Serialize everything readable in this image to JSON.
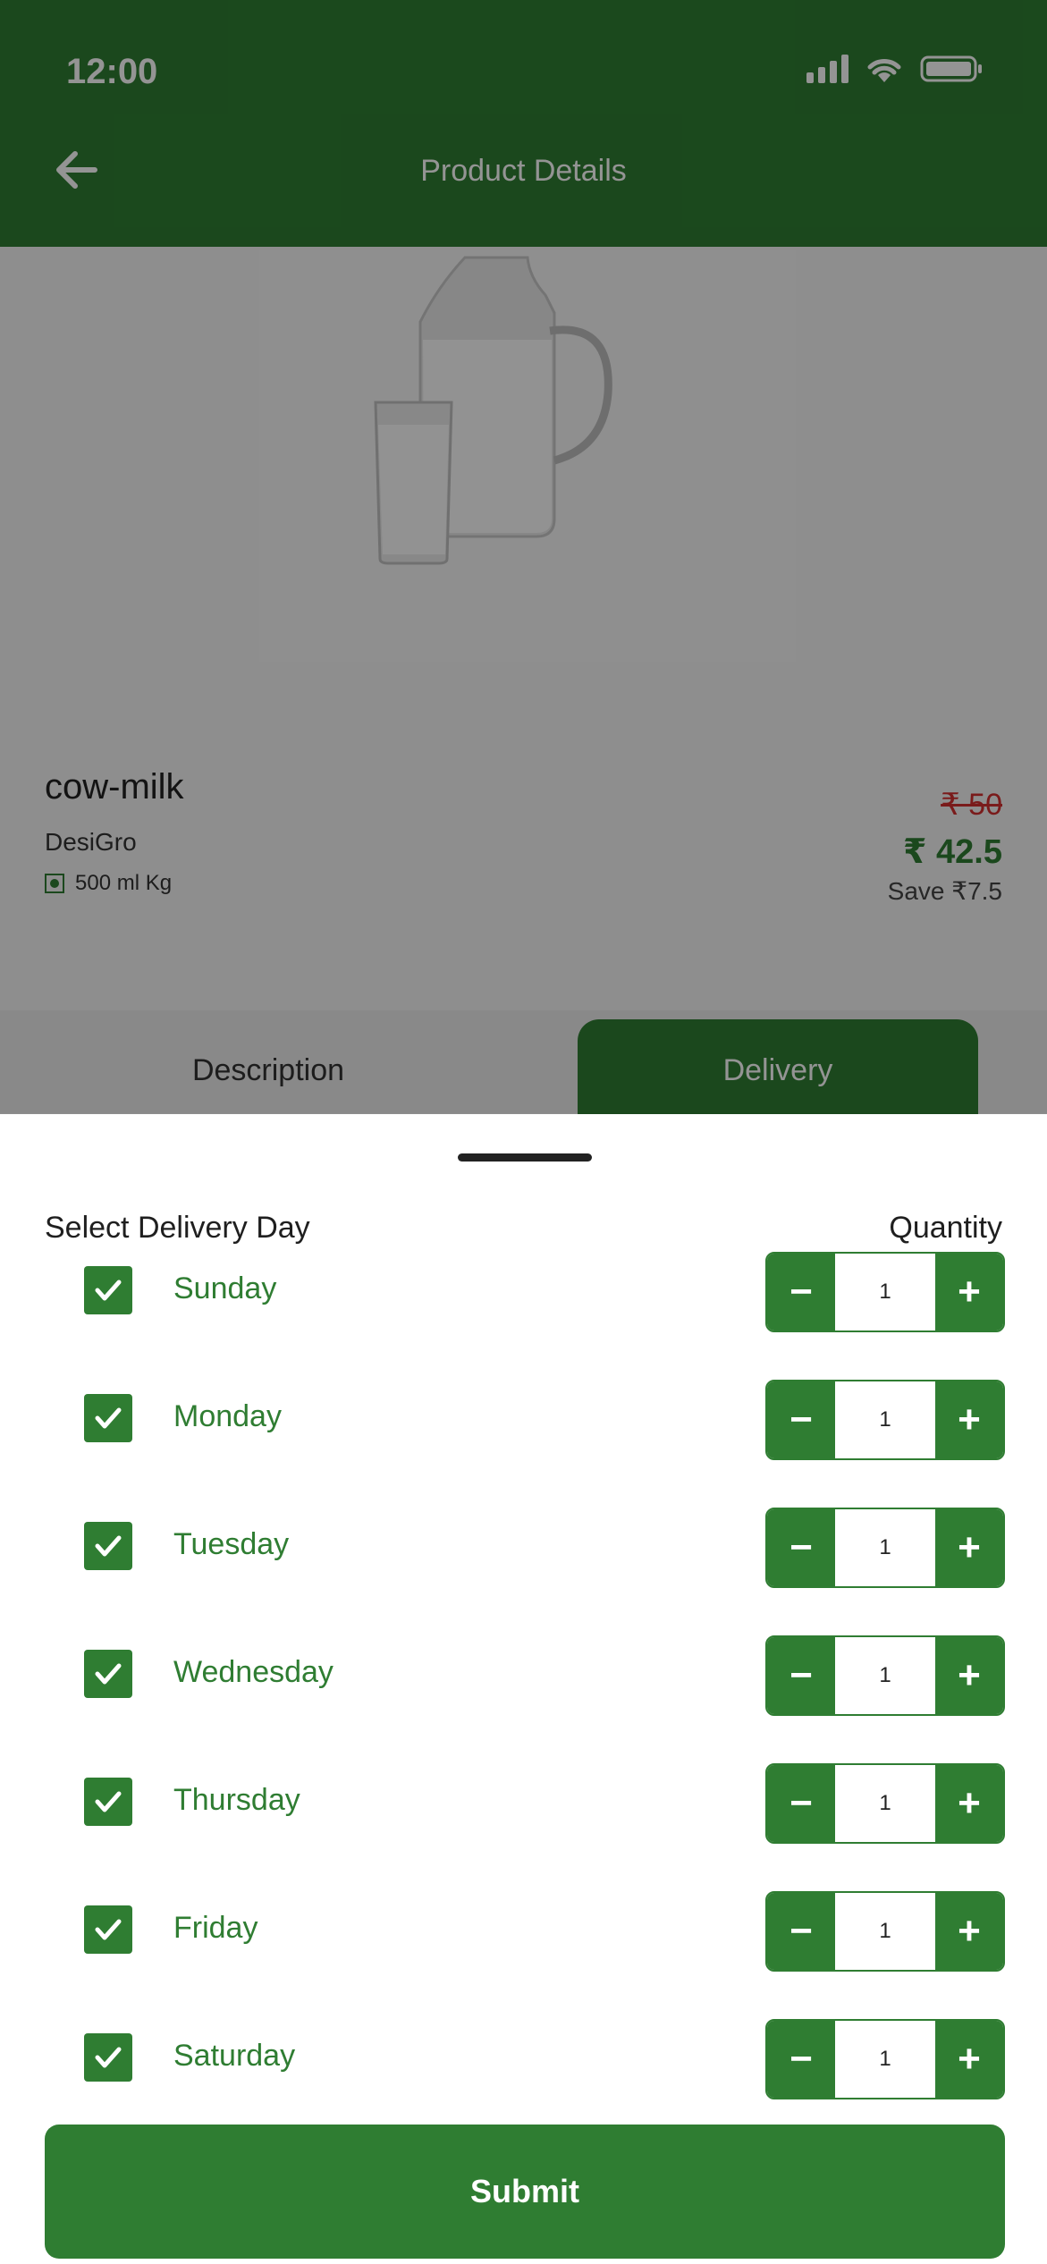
{
  "status_bar": {
    "time": "12:00"
  },
  "header": {
    "title": "Product Details"
  },
  "product": {
    "name": "cow-milk",
    "brand": "DesiGro",
    "size": "500 ml Kg",
    "price_original": "₹ 50",
    "price_current": "₹ 42.5",
    "savings": "Save ₹7.5"
  },
  "tabs": [
    {
      "label": "Description"
    },
    {
      "label": "Delivery"
    }
  ],
  "sheet": {
    "title": "Select Delivery Day",
    "quantity_header": "Quantity",
    "days": [
      {
        "label": "Sunday",
        "checked": true,
        "quantity": "1"
      },
      {
        "label": "Monday",
        "checked": true,
        "quantity": "1"
      },
      {
        "label": "Tuesday",
        "checked": true,
        "quantity": "1"
      },
      {
        "label": "Wednesday",
        "checked": true,
        "quantity": "1"
      },
      {
        "label": "Thursday",
        "checked": true,
        "quantity": "1"
      },
      {
        "label": "Friday",
        "checked": true,
        "quantity": "1"
      },
      {
        "label": "Saturday",
        "checked": true,
        "quantity": "1"
      }
    ],
    "minus_symbol": "−",
    "plus_symbol": "+",
    "submit_label": "Submit"
  },
  "colors": {
    "brand_green": "#2f7d32",
    "strike_red": "#d32f2f"
  }
}
